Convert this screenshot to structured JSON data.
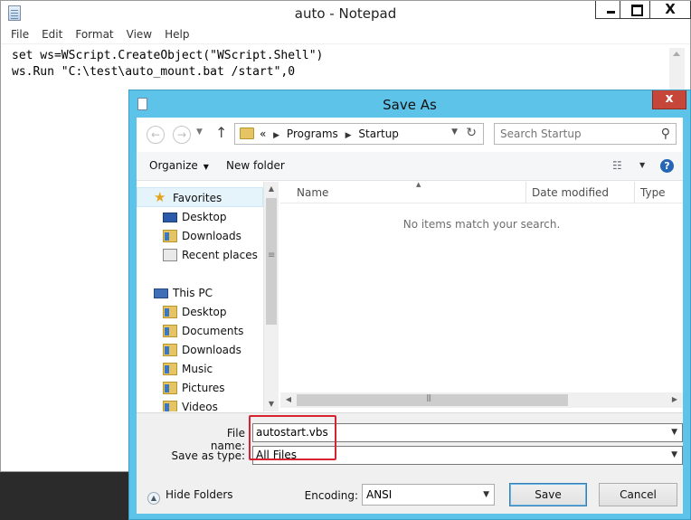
{
  "notepad": {
    "title": "auto - Notepad",
    "close_glyph": "X",
    "menu": [
      "File",
      "Edit",
      "Format",
      "View",
      "Help"
    ],
    "content_lines": [
      "set ws=WScript.CreateObject(\"WScript.Shell\")",
      "ws.Run \"C:\\test\\auto_mount.bat /start\",0"
    ]
  },
  "dialog": {
    "title": "Save As",
    "close_glyph": "x",
    "address": {
      "prefix": "«",
      "segments": [
        "Programs",
        "Startup"
      ]
    },
    "search_placeholder": "Search Startup",
    "toolbar": {
      "organize_label": "Organize",
      "new_folder_label": "New folder",
      "help_glyph": "?"
    },
    "nav_pane": {
      "favorites": {
        "label": "Favorites",
        "items": [
          "Desktop",
          "Downloads",
          "Recent places"
        ]
      },
      "this_pc": {
        "label": "This PC",
        "items": [
          "Desktop",
          "Documents",
          "Downloads",
          "Music",
          "Pictures",
          "Videos"
        ]
      }
    },
    "file_list": {
      "columns": [
        "Name",
        "Date modified",
        "Type"
      ],
      "empty_message": "No items match your search."
    },
    "form": {
      "file_name_label": "File name:",
      "file_name_value": "autostart.vbs",
      "save_as_type_label": "Save as type:",
      "save_as_type_value": "All Files",
      "hide_folders_label": "Hide Folders",
      "encoding_label": "Encoding:",
      "encoding_value": "ANSI",
      "save_label": "Save",
      "cancel_label": "Cancel"
    }
  },
  "colors": {
    "dialog_frame": "#5ec3e8",
    "dialog_close": "#c7463a",
    "highlight_annotation": "#d92231"
  }
}
